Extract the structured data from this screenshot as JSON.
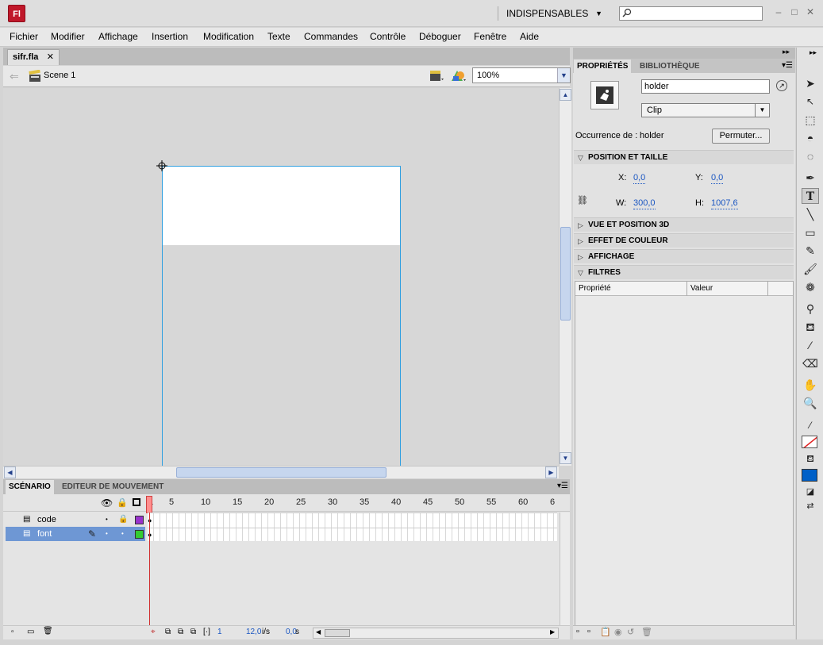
{
  "app": {
    "logo": "Fl",
    "workspace": "INDISPENSABLES",
    "search_placeholder": ""
  },
  "menubar": [
    "Fichier",
    "Modifier",
    "Affichage",
    "Insertion",
    "Modification",
    "Texte",
    "Commandes",
    "Contrôle",
    "Déboguer",
    "Fenêtre",
    "Aide"
  ],
  "document": {
    "tab": "sifr.fla",
    "scene": "Scene 1",
    "zoom": "100%"
  },
  "timeline": {
    "tabs": [
      "SCÉNARIO",
      "EDITEUR DE MOUVEMENT"
    ],
    "frame_numbers": [
      "1",
      "5",
      "10",
      "15",
      "20",
      "25",
      "30",
      "35",
      "40",
      "45",
      "50",
      "55",
      "60",
      "6"
    ],
    "layers": [
      {
        "name": "code"
      },
      {
        "name": "font"
      }
    ],
    "current_frame": "1",
    "frame_rate": "12,0",
    "frame_rate_unit": "i/s",
    "time": "0,0",
    "time_unit": "s",
    "layer_colors": {
      "code": "#9933cc",
      "font": "#33cc33"
    }
  },
  "properties": {
    "tabs": [
      "PROPRIÉTÉS",
      "BIBLIOTHÈQUE"
    ],
    "instance_name": "holder",
    "type": "Clip",
    "instance_of_label": "Occurrence de :",
    "instance_of": "holder",
    "swap_button": "Permuter...",
    "sections": {
      "position": "POSITION ET TAILLE",
      "view3d": "VUE ET POSITION 3D",
      "color": "EFFET DE COULEUR",
      "display": "AFFICHAGE",
      "filters": "FILTRES"
    },
    "x_label": "X:",
    "x": "0,0",
    "y_label": "Y:",
    "y": "0,0",
    "w_label": "W:",
    "w": "300,0",
    "h_label": "H:",
    "h": "1007,6",
    "filter_cols": [
      "Propriété",
      "Valeur"
    ]
  },
  "colors": {
    "fill": "#0060c8",
    "selection_layer": "#6e97d4",
    "stage_outline": "#2f9fe0"
  }
}
